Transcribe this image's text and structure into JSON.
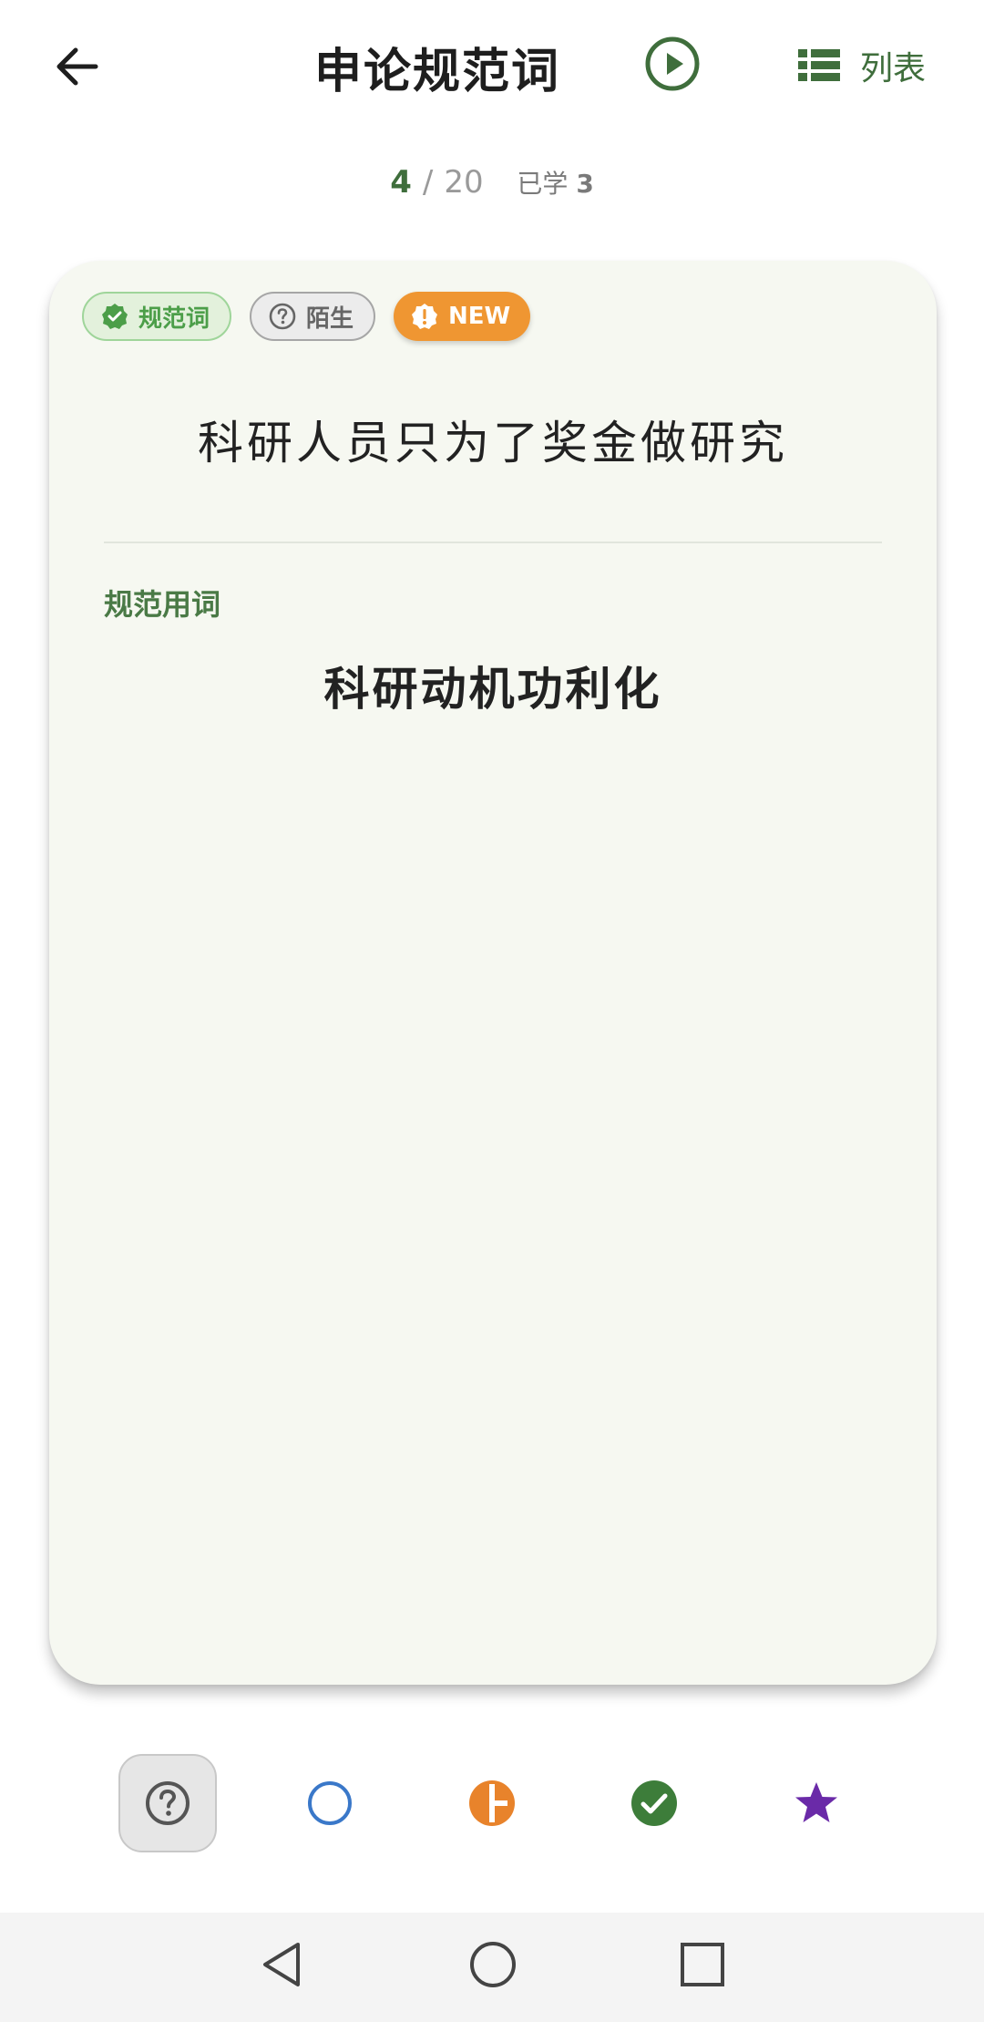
{
  "header": {
    "title": "申论规范词",
    "list_label": "列表",
    "icons": {
      "back": "arrow-left-icon",
      "play": "play-circle-icon",
      "list": "list-icon"
    },
    "accent_color": "#3f6e3c"
  },
  "progress": {
    "current": "4",
    "separator": "/",
    "total": "20",
    "learned_label": "已学",
    "learned_count": "3"
  },
  "card": {
    "chips": [
      {
        "label": "规范词",
        "icon": "verified-badge-icon",
        "color": "#4c9e49"
      },
      {
        "label": "陌生",
        "icon": "question-circle-icon",
        "color": "#666666"
      },
      {
        "label": "NEW",
        "icon": "alert-badge-icon",
        "color": "#ef9632"
      }
    ],
    "phrase": "科研人员只为了奖金做研究",
    "section_label": "规范用词",
    "answer": "科研动机功利化",
    "background": "#f6f8f1"
  },
  "actions": [
    {
      "name": "unknown",
      "icon": "question-circle-icon",
      "color": "#555555",
      "selected": true
    },
    {
      "name": "new",
      "icon": "empty-circle-icon",
      "color": "#3a78c9"
    },
    {
      "name": "partial",
      "icon": "half-circle-icon",
      "color": "#e8832b"
    },
    {
      "name": "mastered",
      "icon": "check-circle-icon",
      "color": "#3d7d3a"
    },
    {
      "name": "favorite",
      "icon": "star-icon",
      "color": "#6a2aa8"
    }
  ],
  "system_nav": {
    "icons": [
      "nav-back-icon",
      "nav-home-icon",
      "nav-recents-icon"
    ]
  }
}
